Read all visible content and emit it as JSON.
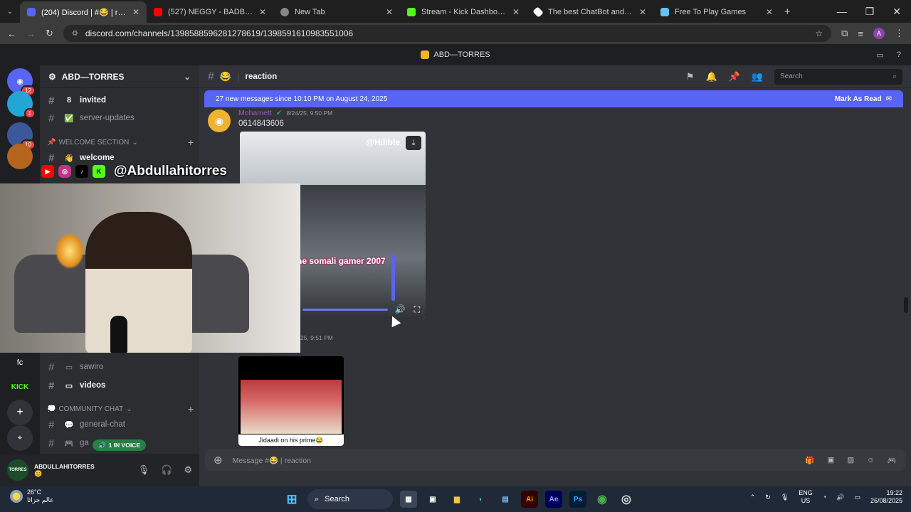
{
  "browser": {
    "tabs": [
      {
        "title": "(204) Discord | #😂 | reaction",
        "color": "#5865f2",
        "active": true
      },
      {
        "title": "(527) NEGGY - BADBOY OFFICI...",
        "color": "#ff0000",
        "active": false
      },
      {
        "title": "New Tab",
        "color": "#dddddd",
        "active": false
      },
      {
        "title": "Stream - Kick Dashboard",
        "color": "#53fc18",
        "active": false
      },
      {
        "title": "The best ChatBot and Widgets",
        "color": "#ffffff",
        "active": false
      },
      {
        "title": "Free To Play Games",
        "color": "#66c0f4",
        "active": false
      }
    ],
    "url": "discord.com/channels/1398588596281278619/1398591610983551006",
    "profile_initial": "A"
  },
  "app": {
    "window_title": "ABD—TORRES"
  },
  "guilds": [
    {
      "label": "",
      "badge": "12",
      "color": "#5865f2"
    },
    {
      "label": "",
      "badge": "1",
      "color": "#23a6d5"
    },
    {
      "label": "",
      "badge": "10",
      "color": "#3b5998"
    },
    {
      "label": "",
      "badge": "",
      "color": "#b5651d"
    },
    {
      "label": "fc",
      "badge": "",
      "color": "#1e1f22"
    },
    {
      "label": "KICK",
      "badge": "",
      "color": "#1e1f22"
    },
    {
      "label": "+",
      "badge": "",
      "color": "#313338"
    },
    {
      "label": "⌖",
      "badge": "",
      "color": "#313338"
    }
  ],
  "server": {
    "name": "ABD—TORRES",
    "channels_top": [
      {
        "name": "invited",
        "emoji": "8",
        "bright": true
      },
      {
        "name": "server-updates",
        "emoji": "✅",
        "bright": false
      }
    ],
    "welcome_category": "WELCOME SECTION",
    "welcome_channel": "welcome",
    "channels_mid": [
      {
        "name": "sawiro",
        "emoji": "▭",
        "bright": false
      },
      {
        "name": "videos",
        "emoji": "▭",
        "bright": true
      }
    ],
    "community_category": "COMMUNITY CHAT",
    "channels_bottom": [
      {
        "name": "general-chat",
        "emoji": "💬",
        "bright": false
      },
      {
        "name": "ga",
        "emoji": "🎮",
        "bright": false
      }
    ],
    "voice_pill": "1 IN VOICE"
  },
  "user": {
    "name": "ABDULLAHITORRES",
    "avatar_text": "TORRES",
    "status_emoji": "😊"
  },
  "channel": {
    "name": "reaction",
    "emoji": "😂",
    "search_placeholder": "Search"
  },
  "new_messages": {
    "text": "27 new messages since 10:10 PM on August 24, 2025",
    "action": "Mark As Read"
  },
  "message1": {
    "author": "Mohamett",
    "timestamp": "8/24/25, 9:50 PM",
    "text": "0614843606",
    "video_watermark": "@Hilible",
    "video_caption": "ne somali gamer 2007",
    "video_progress": 0.75,
    "volume_level": 1.0
  },
  "message2": {
    "timestamp": "25, 9:51 PM",
    "video_caption": "Jidaadi on his prime😂"
  },
  "composer": {
    "placeholder": "Message #😂 | reaction"
  },
  "stream_overlay": {
    "handle": "@Abdullahitorres"
  },
  "taskbar": {
    "temperature": "26°C",
    "weather_label": "عالم جزائا",
    "search_label": "Search",
    "lang_top": "ENG",
    "lang_bottom": "US",
    "time": "19:22",
    "date": "26/08/2025"
  }
}
